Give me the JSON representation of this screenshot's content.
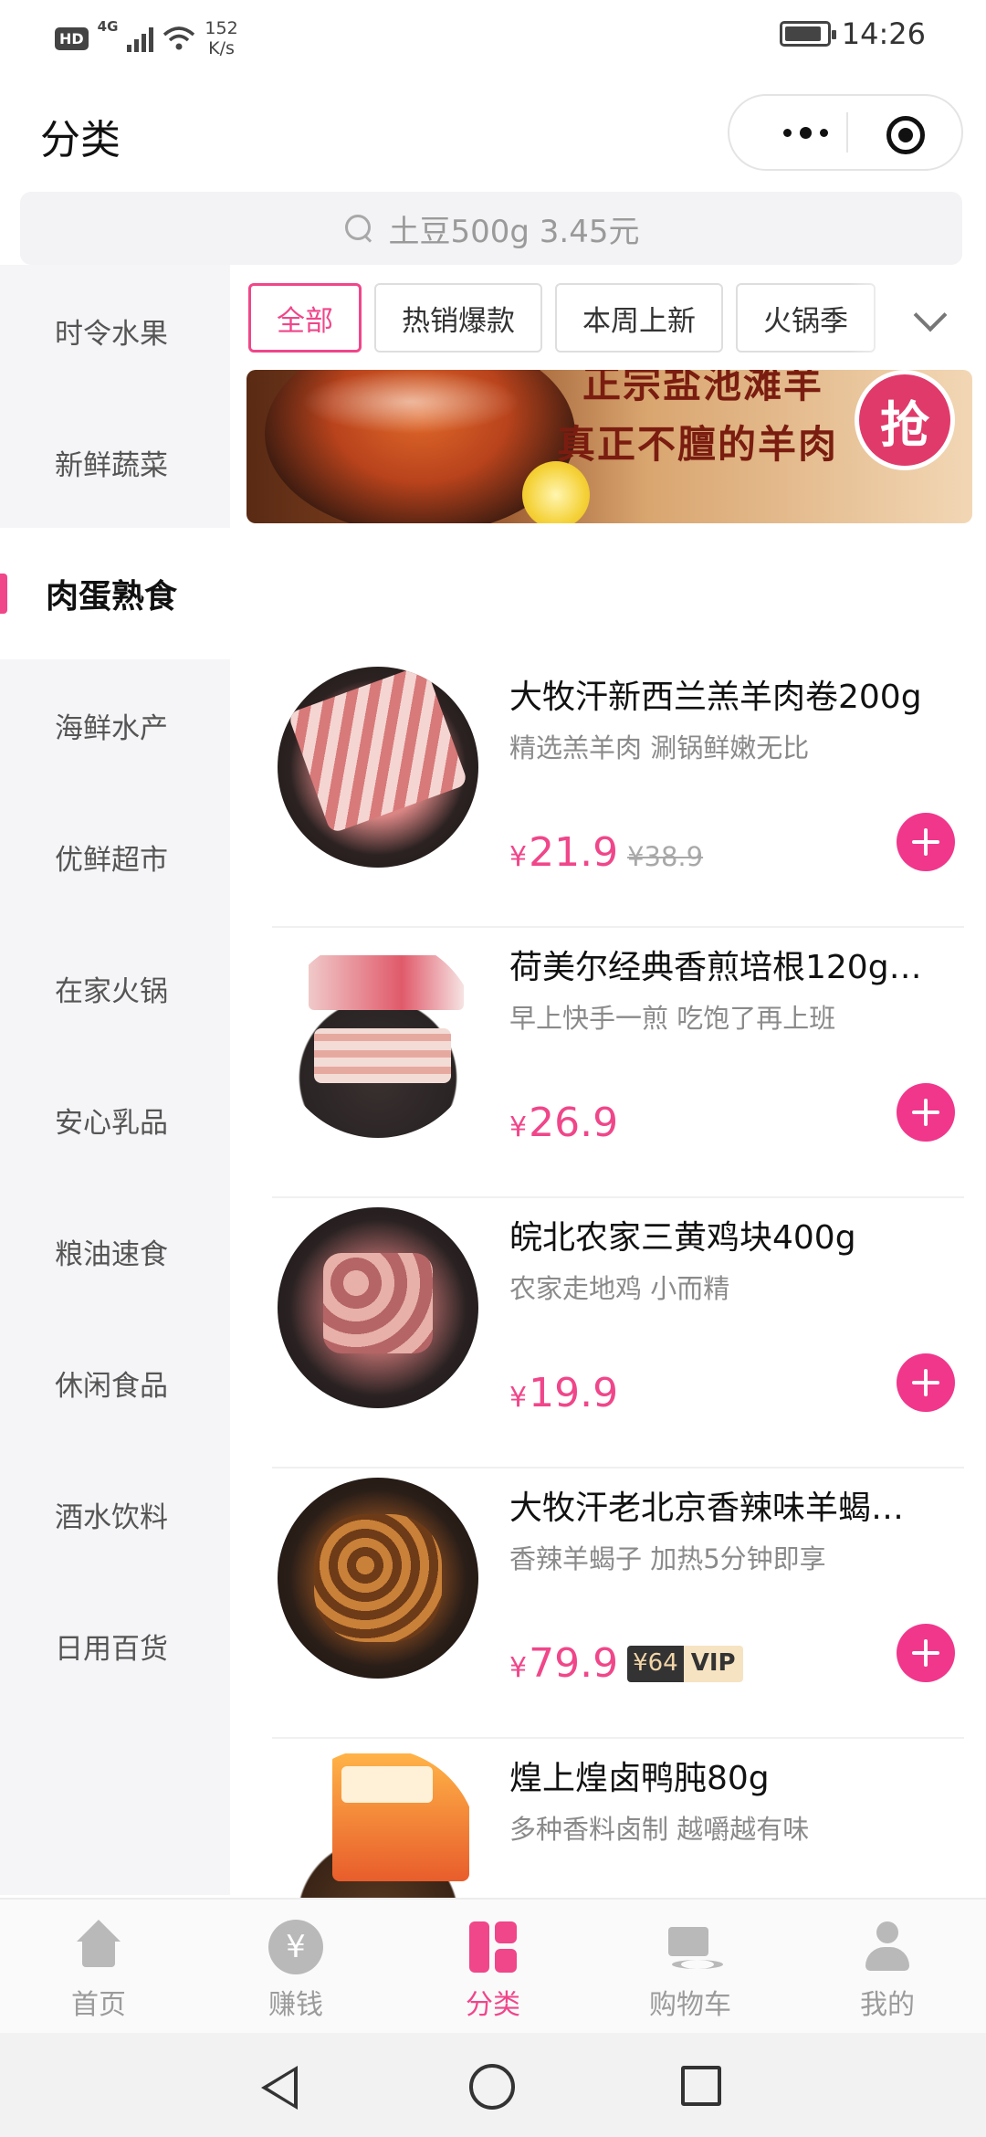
{
  "status_bar": {
    "hd": "HD",
    "network": "4G",
    "speed_value": "152",
    "speed_unit": "K/s",
    "time": "14:26",
    "battery_level": 0.9
  },
  "header": {
    "title": "分类"
  },
  "search": {
    "placeholder": "土豆500g 3.45元"
  },
  "sidebar": {
    "items": [
      {
        "label": "时令水果"
      },
      {
        "label": "新鲜蔬菜"
      },
      {
        "label": "肉蛋熟食",
        "active": true
      },
      {
        "label": "海鲜水产"
      },
      {
        "label": "优鲜超市"
      },
      {
        "label": "在家火锅"
      },
      {
        "label": "安心乳品"
      },
      {
        "label": "粮油速食"
      },
      {
        "label": "休闲食品"
      },
      {
        "label": "酒水饮料"
      },
      {
        "label": "日用百货"
      }
    ]
  },
  "filters": {
    "chips": [
      {
        "label": "全部",
        "active": true
      },
      {
        "label": "热销爆款"
      },
      {
        "label": "本周上新"
      },
      {
        "label": "火锅季"
      }
    ]
  },
  "banner": {
    "line1": "正宗盐池滩羊",
    "line2": "真正不膻的羊肉",
    "badge": "抢"
  },
  "products": [
    {
      "name": "大牧汗新西兰羔羊肉卷200g",
      "desc": "精选羔羊肉 涮锅鲜嫩无比",
      "currency": "¥",
      "price": "21.9",
      "old_price": "¥38.9"
    },
    {
      "name": "荷美尔经典香煎培根120g…",
      "desc": "早上快手一煎 吃饱了再上班",
      "currency": "¥",
      "price": "26.9"
    },
    {
      "name": "皖北农家三黄鸡块400g",
      "desc": "农家走地鸡 小而精",
      "currency": "¥",
      "price": "19.9"
    },
    {
      "name": "大牧汗老北京香辣味羊蝎…",
      "desc": "香辣羊蝎子 加热5分钟即享",
      "currency": "¥",
      "price": "79.9",
      "vip_price": "¥64",
      "vip_label": "VIP"
    },
    {
      "name": "煌上煌卤鸭肫80g",
      "desc": "多种香料卤制 越嚼越有味",
      "currency": "¥",
      "price": ""
    }
  ],
  "bottom_nav": {
    "items": [
      {
        "label": "首页",
        "icon": "home-icon"
      },
      {
        "label": "赚钱",
        "icon": "yen-coin-icon",
        "glyph": "¥"
      },
      {
        "label": "分类",
        "icon": "category-icon",
        "active": true
      },
      {
        "label": "购物车",
        "icon": "cart-icon"
      },
      {
        "label": "我的",
        "icon": "profile-icon"
      }
    ]
  },
  "colors": {
    "accent": "#f0468a",
    "sidebar_bg": "#f5f5f7",
    "muted_text": "#8a8a8a"
  }
}
